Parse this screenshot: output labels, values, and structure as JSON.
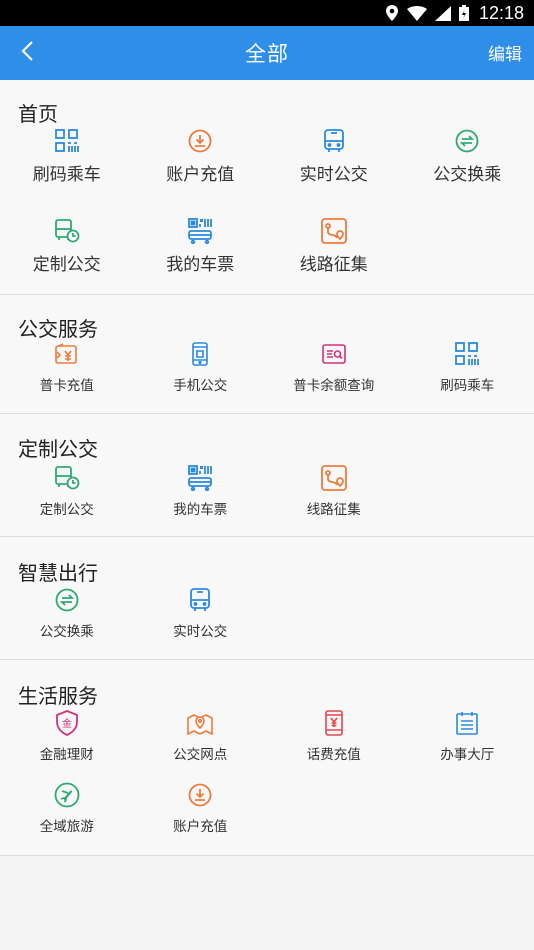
{
  "status": {
    "time": "12:18"
  },
  "appbar": {
    "title": "全部",
    "edit": "编辑"
  },
  "sections": {
    "home": {
      "title": "首页",
      "items": [
        "刷码乘车",
        "账户充值",
        "实时公交",
        "公交换乘",
        "定制公交",
        "我的车票",
        "线路征集"
      ]
    },
    "bus": {
      "title": "公交服务",
      "items": [
        "普卡充值",
        "手机公交",
        "普卡余额查询",
        "刷码乘车"
      ]
    },
    "custom": {
      "title": "定制公交",
      "items": [
        "定制公交",
        "我的车票",
        "线路征集"
      ]
    },
    "smart": {
      "title": "智慧出行",
      "items": [
        "公交换乘",
        "实时公交"
      ]
    },
    "life": {
      "title": "生活服务",
      "items": [
        "金融理财",
        "公交网点",
        "话费充值",
        "办事大厅",
        "全域旅游",
        "账户充值"
      ]
    }
  },
  "colors": {
    "primary": "#2f8ee8",
    "blue": "#2a8ae0",
    "orange": "#f07a3c",
    "green": "#2eaa70",
    "pink": "#d6307a",
    "red": "#e8454b"
  }
}
